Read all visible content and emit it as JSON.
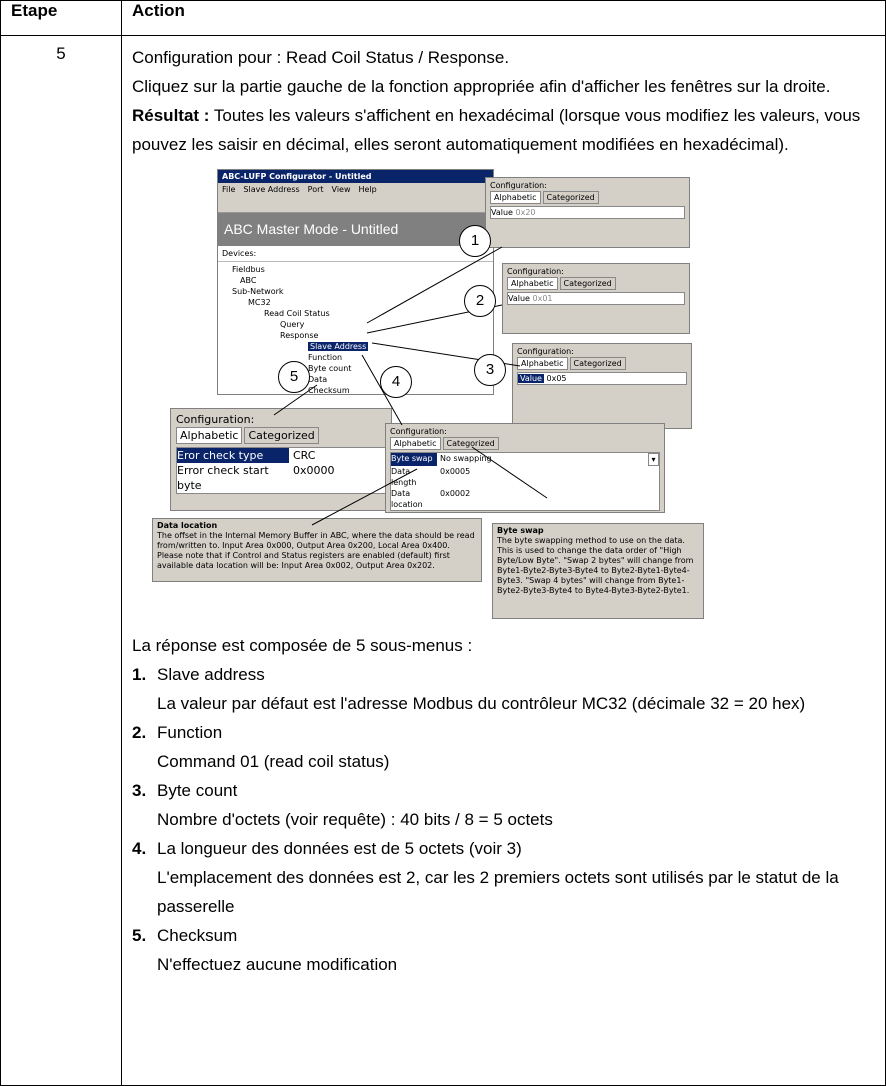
{
  "header": {
    "col1": "Etape",
    "col2": "Action"
  },
  "step": "5",
  "intro": {
    "line1": "Configuration pour : Read Coil Status / Response.",
    "line2": "Cliquez sur la partie gauche de la fonction appropriée afin d'afficher les fenêtres sur la droite.",
    "result_label": "Résultat :",
    "result_text": " Toutes les valeurs s'affichent en hexadécimal (lorsque vous modifiez les valeurs, vous pouvez les saisir en décimal, elles seront automatiquement modifiées en hexadécimal)."
  },
  "screenshot": {
    "app_title": "ABC-LUFP Configurator - Untitled",
    "menu": [
      "File",
      "Slave Address",
      "Port",
      "View",
      "Help"
    ],
    "mode_title": "ABC Master Mode - Untitled",
    "devices_label": "Devices:",
    "tree": [
      "Fieldbus",
      "ABC",
      "Sub-Network",
      "MC32",
      "Read Coil Status",
      "Query",
      "Response",
      "Slave Address",
      "Function",
      "Byte count",
      "Data",
      "Checksum"
    ],
    "config_label": "Configuration:",
    "tab_alpha": "Alphabetic",
    "tab_cat": "Categorized",
    "value_label": "Value",
    "v1": "0x20",
    "v2": "0x01",
    "v3": "0x05",
    "check_rows": [
      {
        "k": "Eror check type",
        "v": "CRC"
      },
      {
        "k": "Error check start byte",
        "v": "0x0000"
      }
    ],
    "data_rows": [
      {
        "k": "Byte swap",
        "v": "No swapping"
      },
      {
        "k": "Data length",
        "v": "0x0005"
      },
      {
        "k": "Data location",
        "v": "0x0002"
      }
    ],
    "callouts": [
      "1",
      "2",
      "3",
      "4",
      "5"
    ],
    "tip1_title": "Data location",
    "tip1_text": "The offset in the Internal Memory Buffer in ABC, where the data should be read from/written to. Input Area 0x000, Output Area 0x200, Local Area 0x400. Please note that if Control and Status registers are enabled (default) first available data location will be: Input Area 0x002, Output Area 0x202.",
    "tip2_title": "Byte swap",
    "tip2_text": "The byte swapping method to use on the data. This is used to change the data order of \"High Byte/Low Byte\". \"Swap 2 bytes\" will change from Byte1-Byte2-Byte3-Byte4 to Byte2-Byte1-Byte4-Byte3. \"Swap 4 bytes\" will change from Byte1-Byte2-Byte3-Byte4 to Byte4-Byte3-Byte2-Byte1."
  },
  "response_intro": "La réponse est composée de 5 sous-menus :",
  "items": [
    {
      "n": "1.",
      "title": "Slave address",
      "desc": "La valeur par défaut est l'adresse Modbus du contrôleur MC32 (décimale 32 = 20 hex)"
    },
    {
      "n": "2.",
      "title": "Function",
      "desc": "Command 01 (read coil status)"
    },
    {
      "n": "3.",
      "title": "Byte count",
      "desc": "Nombre d'octets (voir requête) : 40 bits / 8 = 5 octets"
    },
    {
      "n": "4.",
      "title": "La longueur des données est de 5 octets (voir 3)",
      "desc": "L'emplacement des données est 2, car les 2 premiers octets sont utilisés par le statut de la passerelle"
    },
    {
      "n": "5.",
      "title": "Checksum",
      "desc": "N'effectuez aucune modification"
    }
  ]
}
